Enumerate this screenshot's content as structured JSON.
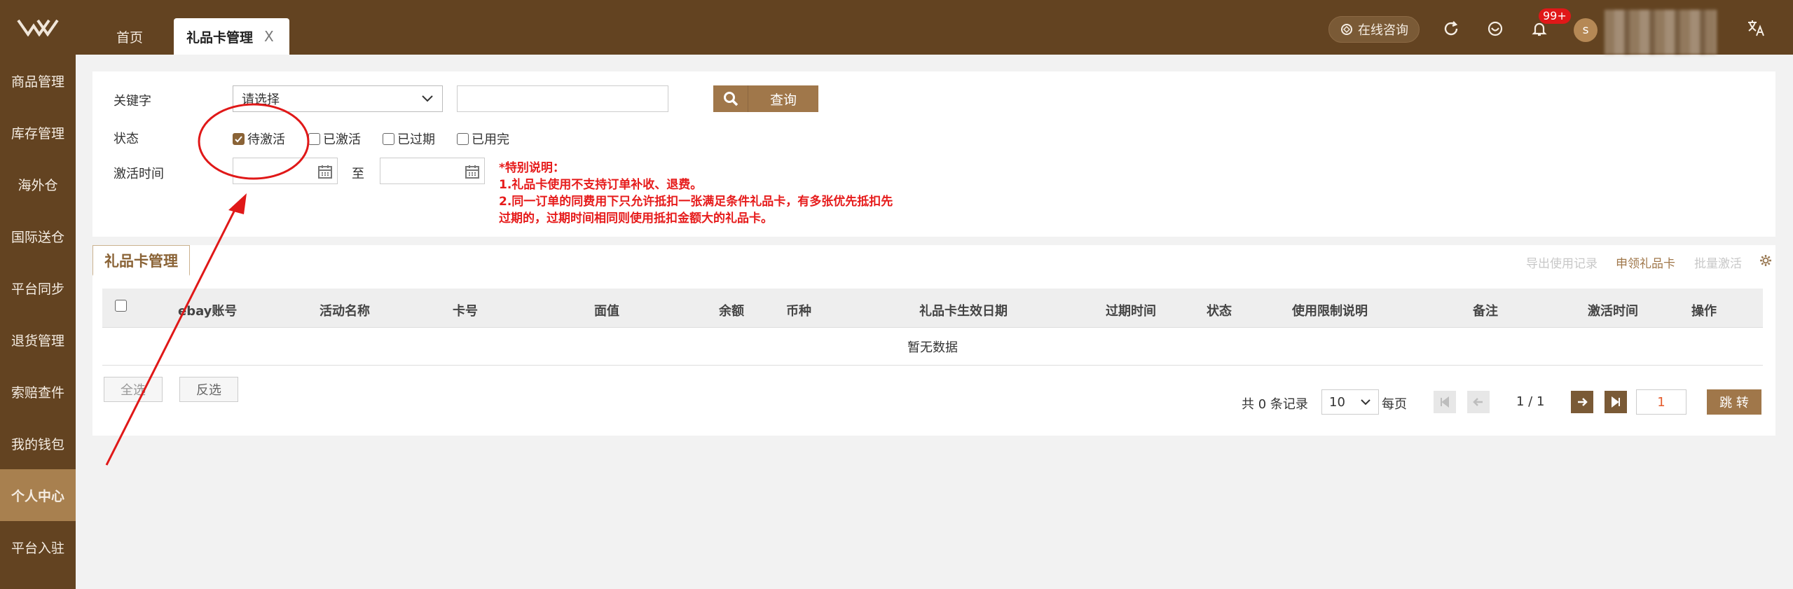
{
  "header": {
    "tabs": [
      {
        "label": "首页"
      },
      {
        "label": "礼品卡管理",
        "close": "X"
      }
    ],
    "consult_label": "在线咨询",
    "notification_badge": "99+",
    "avatar_letter": "s"
  },
  "sidebar": {
    "items": [
      {
        "label": "商品管理"
      },
      {
        "label": "库存管理"
      },
      {
        "label": "海外仓"
      },
      {
        "label": "国际送仓"
      },
      {
        "label": "平台同步"
      },
      {
        "label": "退货管理"
      },
      {
        "label": "索赔查件"
      },
      {
        "label": "我的钱包"
      },
      {
        "label": "个人中心"
      },
      {
        "label": "平台入驻"
      }
    ]
  },
  "filters": {
    "keyword_label": "关键字",
    "keyword_select": "请选择",
    "keyword_value": "",
    "query_label": "查询",
    "status_label": "状态",
    "status_options": [
      {
        "label": "待激活",
        "checked": true
      },
      {
        "label": "已激活",
        "checked": false
      },
      {
        "label": "已过期",
        "checked": false
      },
      {
        "label": "已用完",
        "checked": false
      }
    ],
    "activation_time_label": "激活时间",
    "to_label": "至",
    "note_lines": [
      "*特别说明：",
      "1.礼品卡使用不支持订单补收、退费。",
      "2.同一订单的同费用下只允许抵扣一张满足条件礼品卡，有多张优先抵扣先",
      "过期的，过期时间相同则使用抵扣金额大的礼品卡。"
    ]
  },
  "card": {
    "tab_label": "礼品卡管理",
    "toolbar": {
      "export_label": "导出使用记录",
      "apply_label": "申领礼品卡",
      "batch_label": "批量激活"
    },
    "columns": [
      "ebay账号",
      "活动名称",
      "卡号",
      "面值",
      "余额",
      "币种",
      "礼品卡生效日期",
      "过期时间",
      "状态",
      "使用限制说明",
      "备注",
      "激活时间",
      "操作"
    ],
    "empty_text": "暂无数据",
    "select_all_label": "全选",
    "invert_label": "反选",
    "pager": {
      "total_text": "共 0 条记录",
      "page_size": "10",
      "per_page_label": "每页",
      "page_info": "1 / 1",
      "page_input": "1",
      "jump_label": "跳 转"
    }
  },
  "colors": {
    "brand": "#634321",
    "accent": "#a0774a",
    "note": "#e61b1b"
  }
}
